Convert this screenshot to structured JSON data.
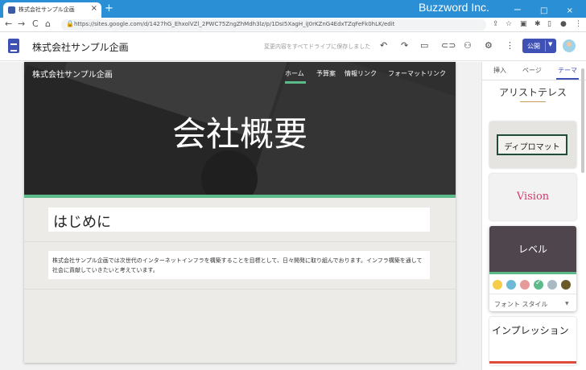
{
  "browser": {
    "tab_title": "株式会社サンプル企画",
    "new_tab": "+",
    "close": "×",
    "brand": "Buzzword Inc.",
    "window_controls": "ー □ ×",
    "url": "https://sites.google.com/d/1427hG_EhxolVZl_2PWC75ZngZhMdh3lz/p/1DsI5XagH_iJ0rKZnG4EdxTZqFeFk0hLK/edit",
    "nav": {
      "back": "←",
      "forward": "→",
      "reload": "C",
      "home": "⌂"
    }
  },
  "toolbar": {
    "site_name": "株式会社サンプル企画",
    "saved_status": "変更内容をすべてドライブに保存しました",
    "publish_label": "公開",
    "icons": [
      "undo-icon",
      "redo-icon",
      "preview-icon",
      "link-icon",
      "add-person-icon",
      "settings-icon",
      "more-icon"
    ]
  },
  "page": {
    "hero_site_name": "株式会社サンプル企画",
    "nav_items": [
      "ホーム",
      "予算案",
      "情報リンク",
      "フォーマットリンク"
    ],
    "hero_title": "会社概要",
    "heading": "はじめに",
    "body_text": "株式会社サンプル企画では次世代のインターネットインフラを構築することを目標として、日々開発に取り組んでおります。インフラ構築を通して社会に貢献していきたいと考えています。"
  },
  "panel": {
    "tabs": [
      "挿入",
      "ページ",
      "テーマ"
    ],
    "themes": {
      "aristotle": "アリストテレス",
      "diplomat": "ディプロマット",
      "vision": "Vision",
      "level": "レベル",
      "impression": "インプレッション"
    },
    "font_style": "フォント スタイル",
    "swatch_colors": [
      "#f4cd4a",
      "#6cbad6",
      "#e69a9a",
      "#5dbb8b",
      "#aabac2",
      "#6b5a28"
    ],
    "accent_color": "#3f51b5"
  }
}
